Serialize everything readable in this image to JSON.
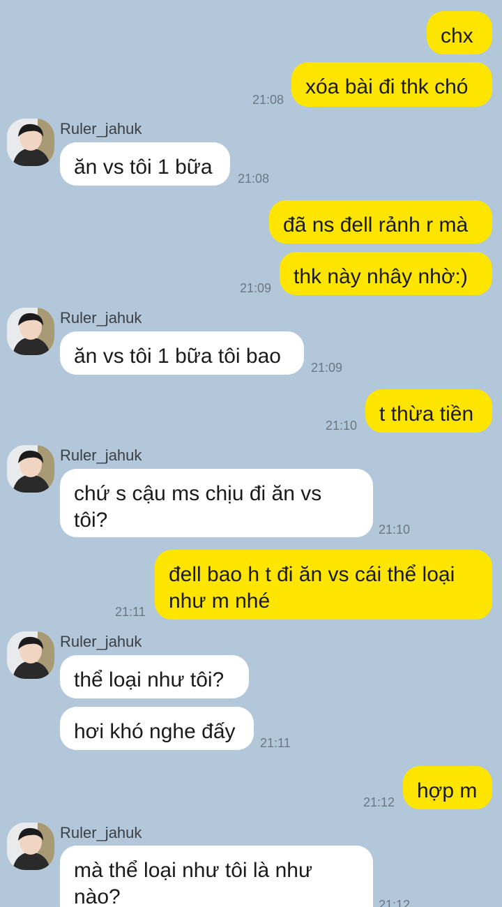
{
  "contact": {
    "name": "Ruler_jahuk",
    "avatar_icon": "profile-photo-icon"
  },
  "colors": {
    "background": "#b2c7d9",
    "my_bubble": "#fee500",
    "their_bubble": "#ffffff",
    "timestamp": "#6b7683"
  },
  "messages": [
    {
      "from": "me",
      "text": "chx"
    },
    {
      "from": "me",
      "text": "xóa bài đi thk chó",
      "time": "21:08"
    },
    {
      "from": "them",
      "text": "ăn vs tôi 1 bữa",
      "time": "21:08"
    },
    {
      "from": "me",
      "text": "đã ns đell rảnh r mà"
    },
    {
      "from": "me",
      "text": "thk này nhây nhờ:)",
      "time": "21:09"
    },
    {
      "from": "them",
      "text": "ăn vs tôi 1 bữa tôi bao",
      "time": "21:09"
    },
    {
      "from": "me",
      "text": "t thừa tiền",
      "time": "21:10"
    },
    {
      "from": "them",
      "text": "chứ s cậu ms chịu đi ăn vs\ntôi?",
      "time": "21:10"
    },
    {
      "from": "me",
      "text": "đell bao h t đi ăn vs cái thể loại\nnhư m nhé",
      "time": "21:11"
    },
    {
      "from": "them",
      "text": "thể loại như tôi?"
    },
    {
      "from": "them",
      "text": "hơi khó nghe đấy",
      "time": "21:11"
    },
    {
      "from": "me",
      "text": "hợp m",
      "time": "21:12"
    },
    {
      "from": "them",
      "text": "mà thể loại như tôi là như\nnào?",
      "time": "21:12"
    }
  ]
}
